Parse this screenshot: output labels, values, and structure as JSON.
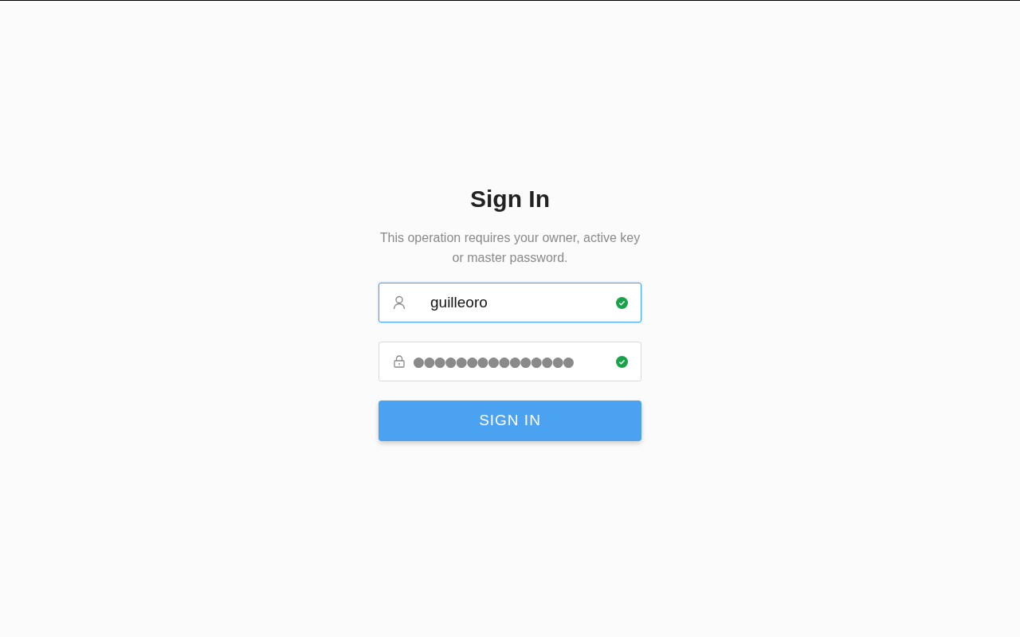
{
  "title": "Sign In",
  "description": "This operation requires your owner, active key or master password.",
  "fields": [
    {
      "kind": "username",
      "value": "guilleoro",
      "focused": true,
      "valid": true
    },
    {
      "kind": "password",
      "value": "●●●●●●●●●●●●●●●",
      "focused": false,
      "valid": true
    }
  ],
  "submit": {
    "label": "SIGN IN"
  }
}
